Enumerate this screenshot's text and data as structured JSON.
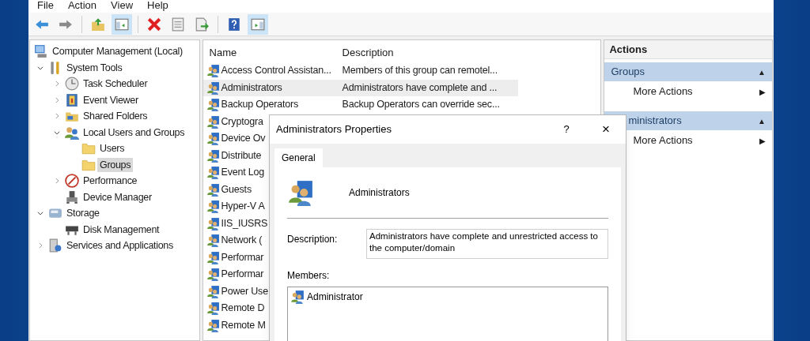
{
  "menu": [
    "File",
    "Action",
    "View",
    "Help"
  ],
  "toolbar": [
    {
      "kind": "back",
      "selected": false
    },
    {
      "kind": "forward",
      "selected": false
    },
    {
      "kind": "up",
      "selected": false
    },
    {
      "kind": "tree",
      "selected": true
    },
    {
      "kind": "delete",
      "selected": false
    },
    {
      "kind": "properties",
      "selected": false
    },
    {
      "kind": "export",
      "selected": false
    },
    {
      "kind": "help",
      "selected": false
    },
    {
      "kind": "pane",
      "selected": true
    }
  ],
  "tree": [
    {
      "label": "Computer Management (Local)",
      "kind": "computer",
      "selected": false,
      "children": [
        {
          "label": "System Tools",
          "kind": "tools",
          "expanded": true,
          "selected": false,
          "children": [
            {
              "label": "Task Scheduler",
              "kind": "clock",
              "expanded": false,
              "selected": false
            },
            {
              "label": "Event Viewer",
              "kind": "event",
              "expanded": false,
              "selected": false
            },
            {
              "label": "Shared Folders",
              "kind": "share",
              "expanded": false,
              "selected": false
            },
            {
              "label": "Local Users and Groups",
              "kind": "users",
              "expanded": true,
              "selected": false,
              "children": [
                {
                  "label": "Users",
                  "kind": "folder",
                  "selected": false
                },
                {
                  "label": "Groups",
                  "kind": "folder",
                  "selected": true
                }
              ]
            },
            {
              "label": "Performance",
              "kind": "perf",
              "expanded": false,
              "selected": false
            },
            {
              "label": "Device Manager",
              "kind": "device",
              "selected": false
            }
          ]
        },
        {
          "label": "Storage",
          "kind": "storage",
          "expanded": true,
          "selected": false,
          "children": [
            {
              "label": "Disk Management",
              "kind": "disk",
              "selected": false
            }
          ]
        },
        {
          "label": "Services and Applications",
          "kind": "services",
          "expanded": false,
          "selected": false
        }
      ]
    }
  ],
  "list": {
    "columns": [
      "Name",
      "Description"
    ],
    "rows": [
      {
        "name": "Access Control Assistan...",
        "description": "Members of this group can remotel...",
        "selected": false
      },
      {
        "name": "Administrators",
        "description": "Administrators have complete and ...",
        "selected": true
      },
      {
        "name": "Backup Operators",
        "description": "Backup Operators can override sec...",
        "selected": false
      },
      {
        "name": "Cryptogra",
        "selected": false
      },
      {
        "name": "Device Ov",
        "selected": false
      },
      {
        "name": "Distribute",
        "selected": false
      },
      {
        "name": "Event Log",
        "selected": false
      },
      {
        "name": "Guests",
        "selected": false
      },
      {
        "name": "Hyper-V A",
        "selected": false
      },
      {
        "name": "IIS_IUSRS",
        "selected": false
      },
      {
        "name": "Network (",
        "selected": false
      },
      {
        "name": "Performar",
        "selected": false
      },
      {
        "name": "Performar",
        "selected": false
      },
      {
        "name": "Power Use",
        "selected": false
      },
      {
        "name": "Remote D",
        "selected": false
      },
      {
        "name": "Remote M",
        "selected": false
      }
    ]
  },
  "actions": {
    "title": "Actions",
    "sections": [
      {
        "title": "Groups",
        "toggle": "▲",
        "items": [
          {
            "label": "More Actions",
            "arrow": "▶"
          }
        ]
      },
      {
        "title": "ministrators",
        "toggle": "▲",
        "items": [
          {
            "label": "More Actions",
            "arrow": "▶"
          }
        ]
      }
    ]
  },
  "dialog": {
    "title": "Administrators Properties",
    "help": "?",
    "close": "×",
    "tabs": [
      {
        "label": "General",
        "selected": true
      }
    ],
    "name": "Administrators",
    "description_label": "Description:",
    "description": "Administrators have complete and unrestricted access to the computer/domain",
    "members_label": "Members:",
    "members": [
      "Administrator"
    ]
  }
}
